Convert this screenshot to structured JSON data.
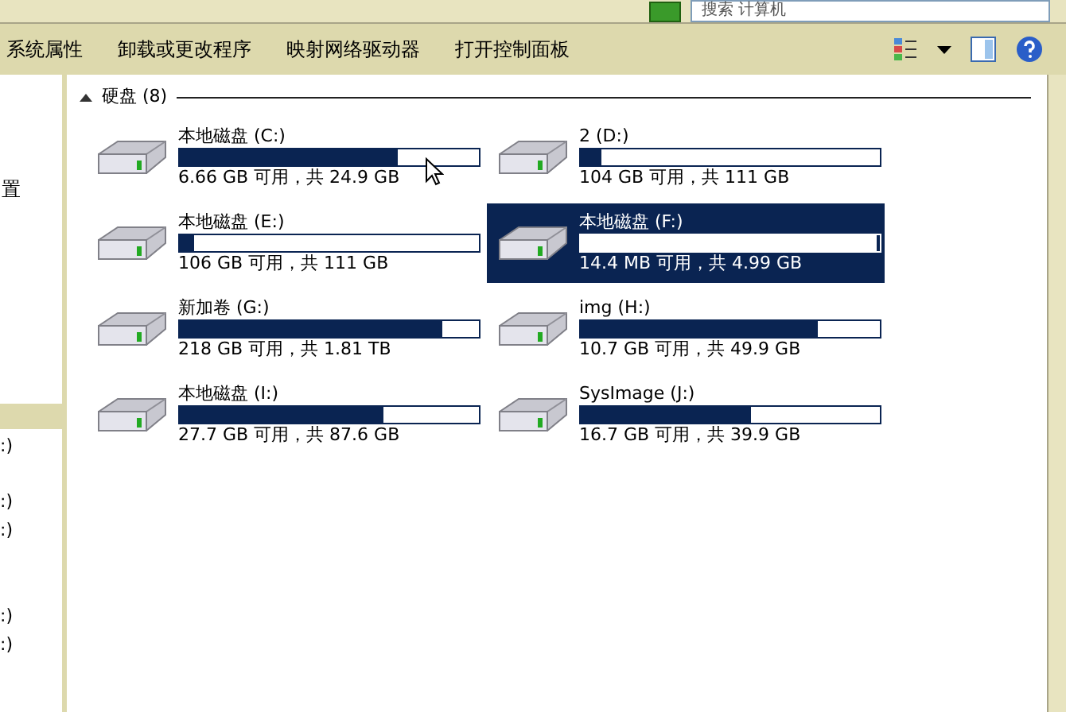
{
  "search": {
    "placeholder": "搜索 计算机"
  },
  "toolbar": {
    "items": [
      "系统属性",
      "卸载或更改程序",
      "映射网络驱动器",
      "打开控制面板"
    ]
  },
  "nav": {
    "items": [
      {
        "label": "置"
      },
      {
        "label": ":)"
      },
      {
        "label": ":)"
      },
      {
        "label": ":)"
      },
      {
        "label": ":)"
      },
      {
        "label": ":)"
      }
    ]
  },
  "group": {
    "title": "硬盘 (8)",
    "expanded": true,
    "drives": [
      {
        "name": "本地磁盘 (C:)",
        "level": 0.73,
        "space": "6.66 GB 可用，共 24.9 GB",
        "selected": false
      },
      {
        "name": "2 (D:)",
        "level": 0.07,
        "space": "104 GB 可用，共 111 GB",
        "selected": false
      },
      {
        "name": "本地磁盘 (E:)",
        "level": 0.05,
        "space": "106 GB 可用，共 111 GB",
        "selected": false
      },
      {
        "name": "本地磁盘 (F:)",
        "level": 0.99,
        "space": "14.4 MB 可用，共 4.99 GB",
        "selected": true
      },
      {
        "name": "新加卷 (G:)",
        "level": 0.88,
        "space": "218 GB 可用，共 1.81 TB",
        "selected": false
      },
      {
        "name": "img (H:)",
        "level": 0.79,
        "space": "10.7 GB 可用，共 49.9 GB",
        "selected": false
      },
      {
        "name": "本地磁盘 (I:)",
        "level": 0.68,
        "space": "27.7 GB 可用，共 87.6 GB",
        "selected": false
      },
      {
        "name": "SysImage (J:)",
        "level": 0.57,
        "space": "16.7 GB 可用，共 39.9 GB",
        "selected": false
      }
    ]
  }
}
